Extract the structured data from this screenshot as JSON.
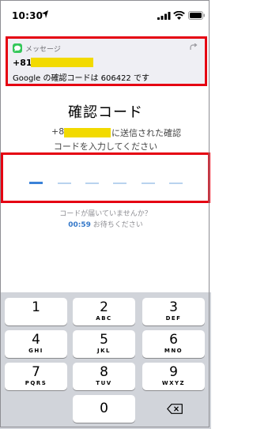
{
  "status_bar": {
    "time": "10:30"
  },
  "notification": {
    "app_name": "メッセージ",
    "sender": "+81",
    "body": "Google の確認コードは 606422 です"
  },
  "verification": {
    "title": "確認コード",
    "desc_prefix": "+81",
    "desc_suffix": "に送信された確認",
    "desc_line2": "コードを入力してください",
    "resend_question": "コードが届いていませんか？",
    "timer": "00:59",
    "timer_suffix": " お待ちください"
  },
  "keypad": {
    "keys": [
      {
        "num": "1",
        "letters": ""
      },
      {
        "num": "2",
        "letters": "ABC"
      },
      {
        "num": "3",
        "letters": "DEF"
      },
      {
        "num": "4",
        "letters": "GHI"
      },
      {
        "num": "5",
        "letters": "JKL"
      },
      {
        "num": "6",
        "letters": "MNO"
      },
      {
        "num": "7",
        "letters": "PQRS"
      },
      {
        "num": "8",
        "letters": "TUV"
      },
      {
        "num": "9",
        "letters": "WXYZ"
      },
      {
        "num": "0",
        "letters": ""
      }
    ]
  },
  "colors": {
    "highlight_border": "#e50012",
    "redaction": "#f2da00",
    "accent_blue": "#3478c9"
  }
}
